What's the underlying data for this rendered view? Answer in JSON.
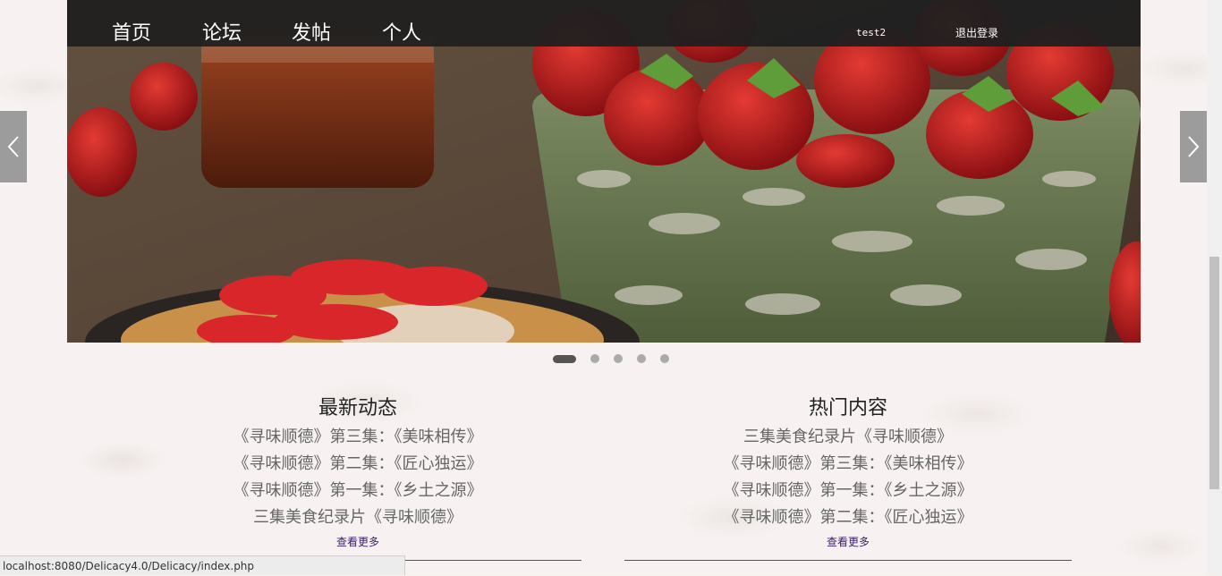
{
  "nav": {
    "items": [
      "首页",
      "论坛",
      "发帖",
      "个人"
    ],
    "username": "test2",
    "logout": "退出登录"
  },
  "carousel": {
    "slide_count": 5,
    "active_index": 0,
    "prev_icon": "chevron-left-icon",
    "next_icon": "chevron-right-icon"
  },
  "latest": {
    "title": "最新动态",
    "items": [
      "《寻味顺德》第三集：《美味相传》",
      "《寻味顺德》第二集：《匠心独运》",
      "《寻味顺德》第一集：《乡土之源》",
      "三集美食纪录片《寻味顺德》"
    ],
    "more": "查看更多"
  },
  "hot": {
    "title": "热门内容",
    "items": [
      "三集美食纪录片《寻味顺德》",
      "《寻味顺德》第三集：《美味相传》",
      "《寻味顺德》第一集：《乡土之源》",
      "《寻味顺德》第二集：《匠心独运》"
    ],
    "more": "查看更多"
  },
  "status_url": "localhost:8080/Delicacy4.0/Delicacy/index.php"
}
